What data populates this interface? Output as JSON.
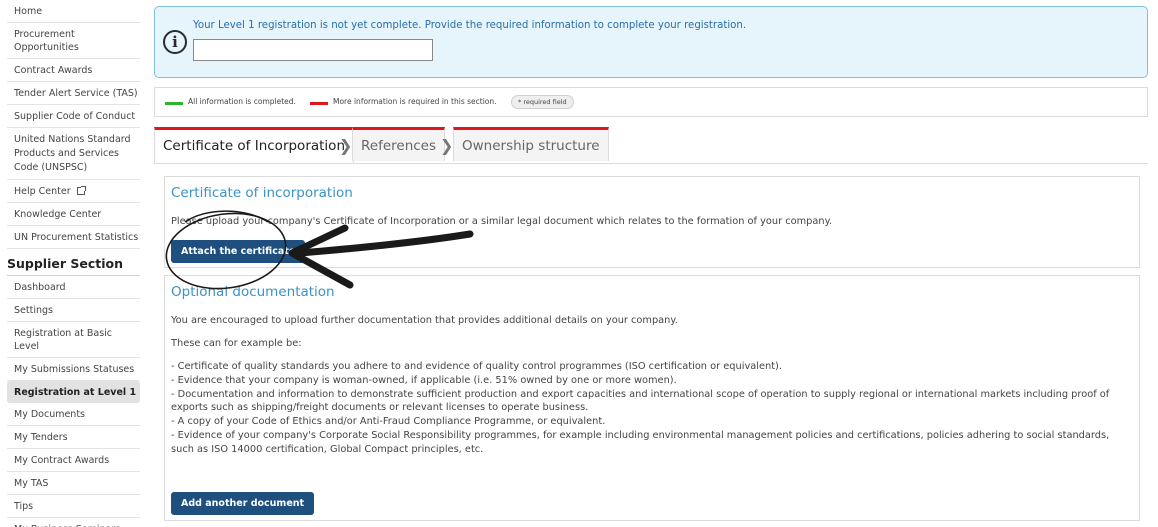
{
  "sidebar": {
    "nav_top": [
      {
        "label": "Home"
      },
      {
        "label": "Procurement Opportunities"
      },
      {
        "label": "Contract Awards"
      },
      {
        "label": "Tender Alert Service (TAS)"
      },
      {
        "label": "Supplier Code of Conduct"
      },
      {
        "label": "United Nations Standard Products and Services Code (UNSPSC)"
      },
      {
        "label": "Help Center",
        "icon": "external-link-icon"
      },
      {
        "label": "Knowledge Center"
      },
      {
        "label": "UN Procurement Statistics"
      }
    ],
    "section_title": "Supplier Section",
    "nav_supplier": [
      {
        "label": "Dashboard"
      },
      {
        "label": "Settings"
      },
      {
        "label": "Registration at Basic Level"
      },
      {
        "label": "My Submissions Statuses"
      },
      {
        "label": "Registration at Level 1",
        "active": true
      },
      {
        "label": "My Documents"
      },
      {
        "label": "My Tenders"
      },
      {
        "label": "My Contract Awards"
      },
      {
        "label": "My TAS"
      },
      {
        "label": "Tips"
      },
      {
        "label": "My Business Seminars"
      }
    ]
  },
  "alert": {
    "icon": "info-icon",
    "message": "Your Level 1 registration is not yet complete. Provide the required information to complete your registration.",
    "input_value": ""
  },
  "legend": {
    "complete_label": "All information is completed.",
    "complete_color": "#2db52d",
    "incomplete_label": "More information is required in this section.",
    "incomplete_color": "#e0161f",
    "required_badge": "* required field"
  },
  "tabs": [
    {
      "label": "Certificate of Incorporation",
      "active": true
    },
    {
      "label": "References",
      "active": false
    },
    {
      "label": "Ownership structure",
      "active": false
    }
  ],
  "certificate_panel": {
    "title": "Certificate of incorporation",
    "description": "Please upload your company's Certificate of Incorporation or a similar legal document which relates to the formation of your company.",
    "button_label": "Attach the certificate"
  },
  "optional_panel": {
    "title": "Optional documentation",
    "intro": "You are encouraged to upload further documentation that provides additional details on your company.",
    "examples_intro": "These can for example be:",
    "examples": [
      "- Certificate of quality standards you adhere to and evidence of quality control programmes (ISO certification or equivalent).",
      "- Evidence that your company is woman-owned, if applicable (i.e. 51% owned by one or more women).",
      "- Documentation and information to demonstrate sufficient production and export capacities and international scope of operation to supply regional or international markets including proof of exports such as shipping/freight documents or relevant licenses to operate business.",
      "- A copy of your Code of Ethics and/or Anti-Fraud Compliance Programme, or equivalent.",
      "- Evidence of your company's Corporate Social Responsibility programmes, for example including environmental management policies and certifications, policies adhering to social standards, such as ISO 14000 certification, Global Compact principles, etc."
    ],
    "button_label": "Add another document"
  },
  "colors": {
    "accent_blue": "#3a93c7",
    "button_blue": "#1e4f7e",
    "tab_marker_red": "#e0161f"
  }
}
